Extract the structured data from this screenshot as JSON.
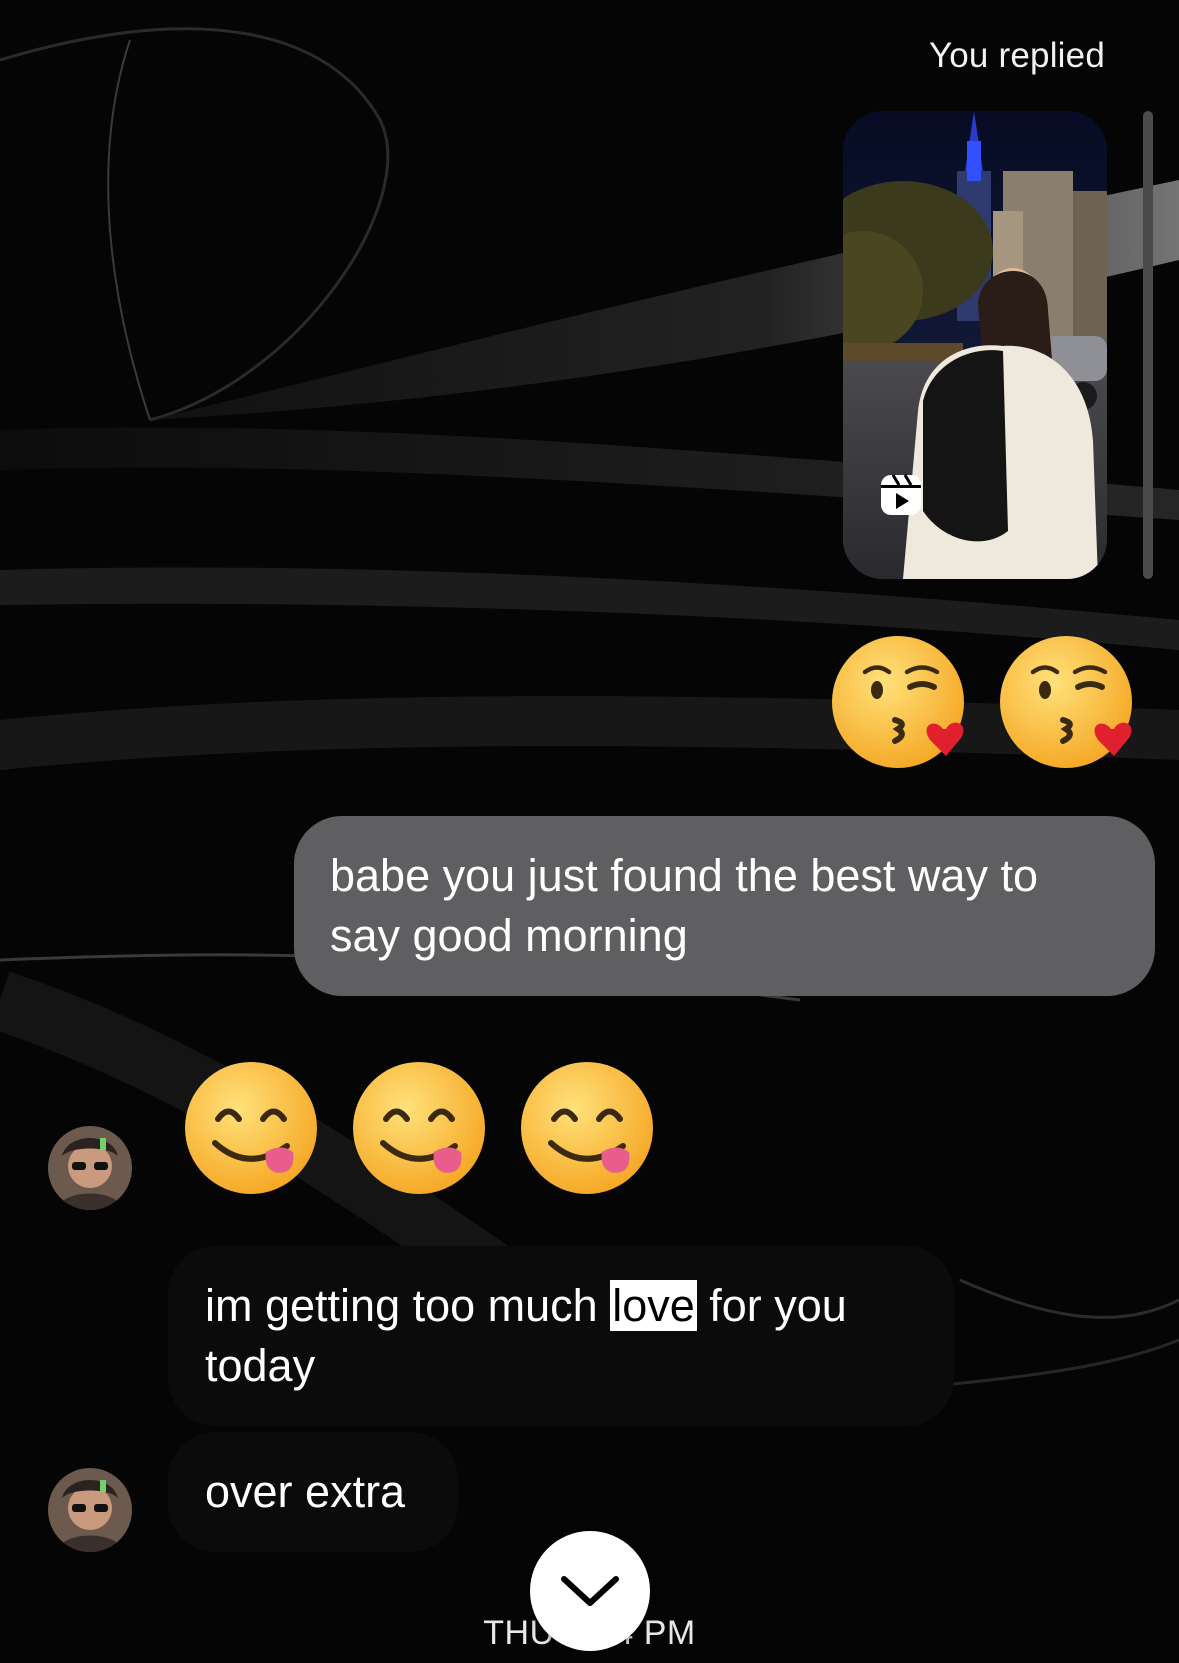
{
  "thread": {
    "reply_label": "You replied",
    "reel_icon": "reels-icon",
    "sent_reaction": {
      "emoji": "face-blowing-a-kiss",
      "count": 2
    },
    "sent_message": "babe you just found the best way to say good morning",
    "received_reaction": {
      "emoji": "face-savoring-food",
      "count": 3
    },
    "received_message_before": "im getting too much ",
    "received_message_highlight": "love",
    "received_message_after": " for you today",
    "received_message_2": "over extra",
    "timestamp_left": "THU",
    "timestamp_right": "4 PM",
    "scroll_down_icon": "chevron-down-icon"
  },
  "colors": {
    "background": "#050505",
    "sent_bubble": "#5f5f61",
    "received_bubble": "#0b0b0b",
    "highlight": "#ffffff"
  }
}
